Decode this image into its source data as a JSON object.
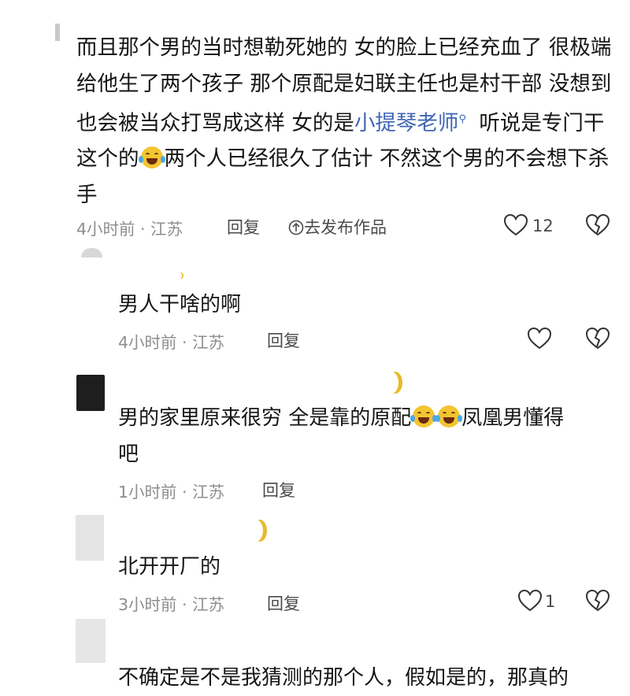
{
  "main_comment": {
    "text_part1": "而且那个男的当时想勒死她的 女的脸上已经充血了 很极端 给他生了两个孩子 那个原配是妇联主任也是村干部 没想到也会被当众打骂成这样 女的是",
    "tag_link": "小提琴老师",
    "text_part2": " 听说是专门干这个的",
    "text_part3": "两个人已经很久了估计 不然这个男的不会想下杀手",
    "time_location": "4小时前 · 江苏",
    "reply_label": "回复",
    "publish_label": "去发布作品",
    "like_count": "12"
  },
  "replies": [
    {
      "text": "男人干啥的啊",
      "time_location": "4小时前 · 江苏",
      "reply_label": "回复"
    },
    {
      "text_part1": "男的家里原来很穷 全是靠的原配",
      "text_part2": "凤凰男懂得",
      "text_part3": "吧",
      "time_location": "1小时前 · 江苏",
      "reply_label": "回复"
    },
    {
      "text": "北开开厂的",
      "time_location": "3小时前 · 江苏",
      "reply_label": "回复",
      "like_count": "1"
    },
    {
      "text": "不确定是不是我猜测的那个人，假如是的，那真的"
    }
  ],
  "icons": {
    "like": "heart-icon",
    "dislike": "broken-heart-icon",
    "publish": "upload-circle-icon",
    "emoji": "laughing-crying-emoji-icon",
    "moon": "moon-icon"
  },
  "colors": {
    "link": "#3f66b3",
    "meta": "#8e8e8e",
    "text": "#161616",
    "emoji": "#f4c431"
  }
}
